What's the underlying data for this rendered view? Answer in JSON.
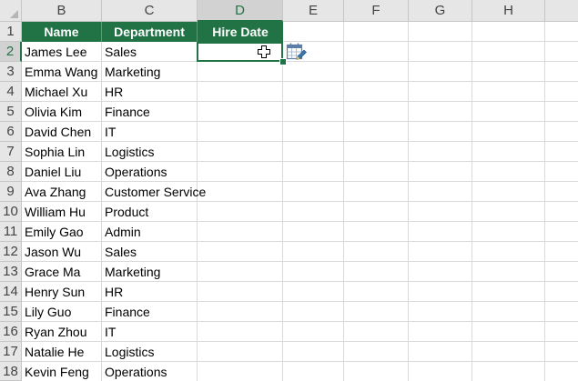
{
  "columns": [
    {
      "letter": "B"
    },
    {
      "letter": "C"
    },
    {
      "letter": "D"
    },
    {
      "letter": "E"
    },
    {
      "letter": "F"
    },
    {
      "letter": "G"
    },
    {
      "letter": "H"
    }
  ],
  "rows": [
    "1",
    "2",
    "3",
    "4",
    "5",
    "6",
    "7",
    "8",
    "9",
    "10",
    "11",
    "12",
    "13",
    "14",
    "15",
    "16",
    "17",
    "18"
  ],
  "table": {
    "headers": {
      "name": "Name",
      "department": "Department",
      "hire_date": "Hire Date"
    },
    "records": [
      {
        "name": "James Lee",
        "department": "Sales"
      },
      {
        "name": "Emma Wang",
        "department": "Marketing"
      },
      {
        "name": "Michael Xu",
        "department": "HR"
      },
      {
        "name": "Olivia Kim",
        "department": "Finance"
      },
      {
        "name": "David Chen",
        "department": "IT"
      },
      {
        "name": "Sophia Lin",
        "department": "Logistics"
      },
      {
        "name": "Daniel Liu",
        "department": "Operations"
      },
      {
        "name": "Ava Zhang",
        "department": "Customer Service"
      },
      {
        "name": "William Hu",
        "department": "Product"
      },
      {
        "name": "Emily Gao",
        "department": "Admin"
      },
      {
        "name": "Jason Wu",
        "department": "Sales"
      },
      {
        "name": "Grace Ma",
        "department": "Marketing"
      },
      {
        "name": "Henry Sun",
        "department": "HR"
      },
      {
        "name": "Lily Guo",
        "department": "Finance"
      },
      {
        "name": "Ryan Zhou",
        "department": "IT"
      },
      {
        "name": "Natalie He",
        "department": "Logistics"
      },
      {
        "name": "Kevin Feng",
        "department": "Operations"
      }
    ]
  },
  "active_cell": {
    "column": "D",
    "row": "2"
  },
  "icons": {
    "cursor": "plus-cursor-icon",
    "quick_action": "calendar-edit-icon"
  },
  "colors": {
    "accent": "#217346",
    "header_bg": "#e6e6e6",
    "grid": "#d9d9d9"
  }
}
